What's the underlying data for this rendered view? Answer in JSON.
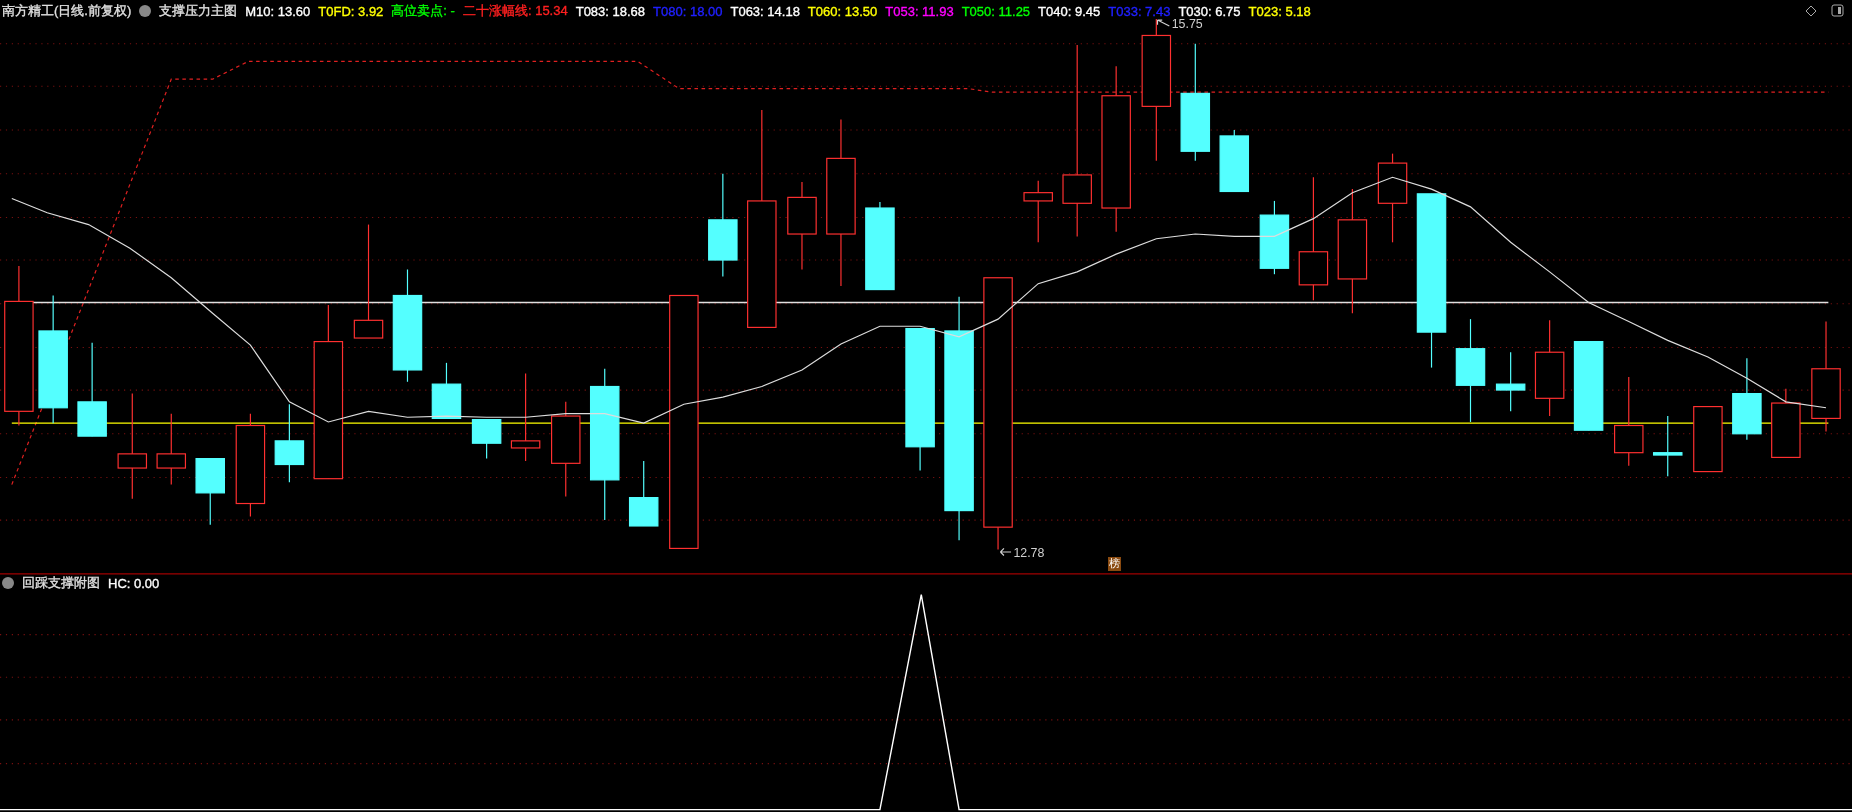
{
  "main_chart": {
    "security_title": "南方精工(日线.前复权)",
    "name": "支撑压力主图",
    "indicators": [
      {
        "label": "M10: 13.60",
        "color": "#ffffff"
      },
      {
        "label": "T0FD: 3.92",
        "color": "#ffff00"
      },
      {
        "label": "高位卖点: -",
        "color": "#00ff00"
      },
      {
        "label": "二十涨幅线: 15.34",
        "color": "#ff2020"
      },
      {
        "label": "T083: 18.68",
        "color": "#ffffff"
      },
      {
        "label": "T080: 18.00",
        "color": "#2020ff"
      },
      {
        "label": "T063: 14.18",
        "color": "#ffffff"
      },
      {
        "label": "T060: 13.50",
        "color": "#ffff00"
      },
      {
        "label": "T053: 11.93",
        "color": "#ff00ff"
      },
      {
        "label": "T050: 11.25",
        "color": "#00ff00"
      },
      {
        "label": "T040: 9.45",
        "color": "#ffffff"
      },
      {
        "label": "T033: 7.43",
        "color": "#2020ff"
      },
      {
        "label": "T030: 6.75",
        "color": "#ffffff"
      },
      {
        "label": "T023: 5.18",
        "color": "#ffff00"
      }
    ],
    "high_marker": "15.75",
    "low_marker": "12.78",
    "badge": "榜"
  },
  "sub_chart": {
    "name": "回踩支撑附图",
    "indicators": [
      {
        "label": "HC: 0.00",
        "color": "#ffffff"
      }
    ]
  }
}
